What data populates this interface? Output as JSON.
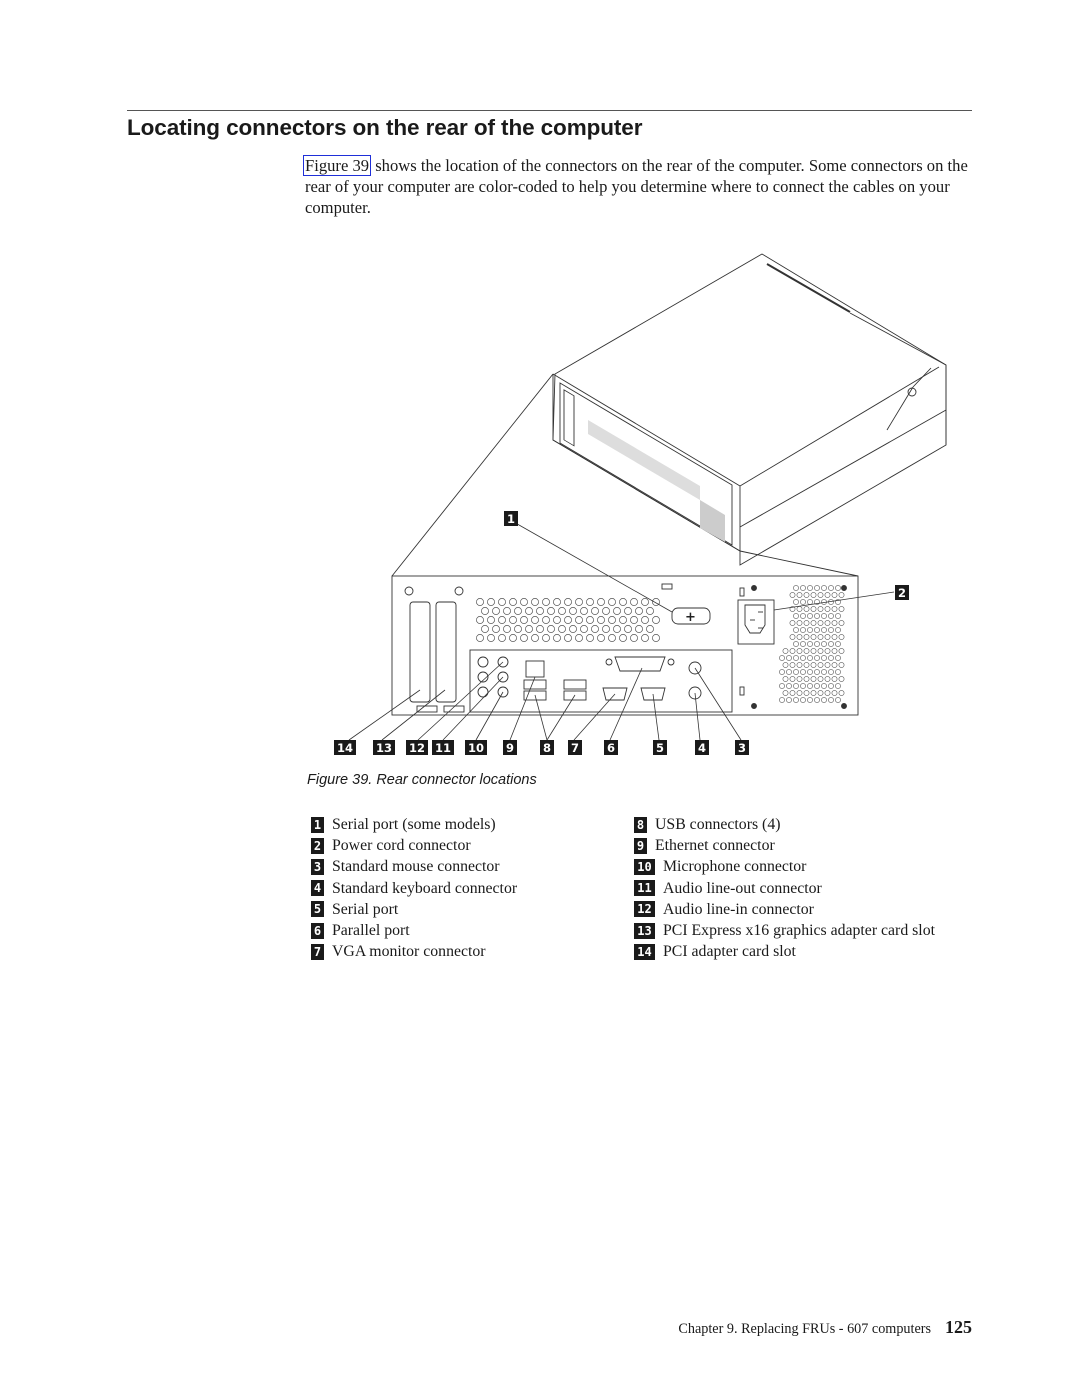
{
  "page": {
    "section_title": "Locating connectors on the rear of the computer",
    "intro": {
      "xref_label": "Figure 39",
      "text": " shows the location of the connectors on the rear of the computer. Some connectors on the rear of your computer are color-coded to help you determine where to connect the cables on your computer."
    },
    "figure": {
      "caption": "Figure 39. Rear connector locations",
      "callouts": [
        "1",
        "2",
        "14",
        "13",
        "12",
        "11",
        "10",
        "9",
        "8",
        "7",
        "6",
        "5",
        "4",
        "3"
      ]
    },
    "legend": {
      "left": [
        {
          "num": "1",
          "label": "Serial port (some models)"
        },
        {
          "num": "2",
          "label": "Power cord connector"
        },
        {
          "num": "3",
          "label": "Standard mouse connector"
        },
        {
          "num": "4",
          "label": "Standard keyboard connector"
        },
        {
          "num": "5",
          "label": "Serial port"
        },
        {
          "num": "6",
          "label": "Parallel port"
        },
        {
          "num": "7",
          "label": "VGA monitor connector"
        }
      ],
      "right": [
        {
          "num": "8",
          "label": "USB connectors (4)"
        },
        {
          "num": "9",
          "label": "Ethernet connector"
        },
        {
          "num": "10",
          "label": "Microphone connector"
        },
        {
          "num": "11",
          "label": "Audio line-out connector"
        },
        {
          "num": "12",
          "label": "Audio line-in connector"
        },
        {
          "num": "13",
          "label": "PCI Express x16 graphics adapter card slot"
        },
        {
          "num": "14",
          "label": "PCI adapter card slot"
        }
      ]
    },
    "footer": {
      "chapter_text": "Chapter 9. Replacing FRUs - 607 computers",
      "page_number": "125"
    },
    "colors": {
      "link_border": "#1f2fd8",
      "text": "#1a1a1a"
    }
  }
}
